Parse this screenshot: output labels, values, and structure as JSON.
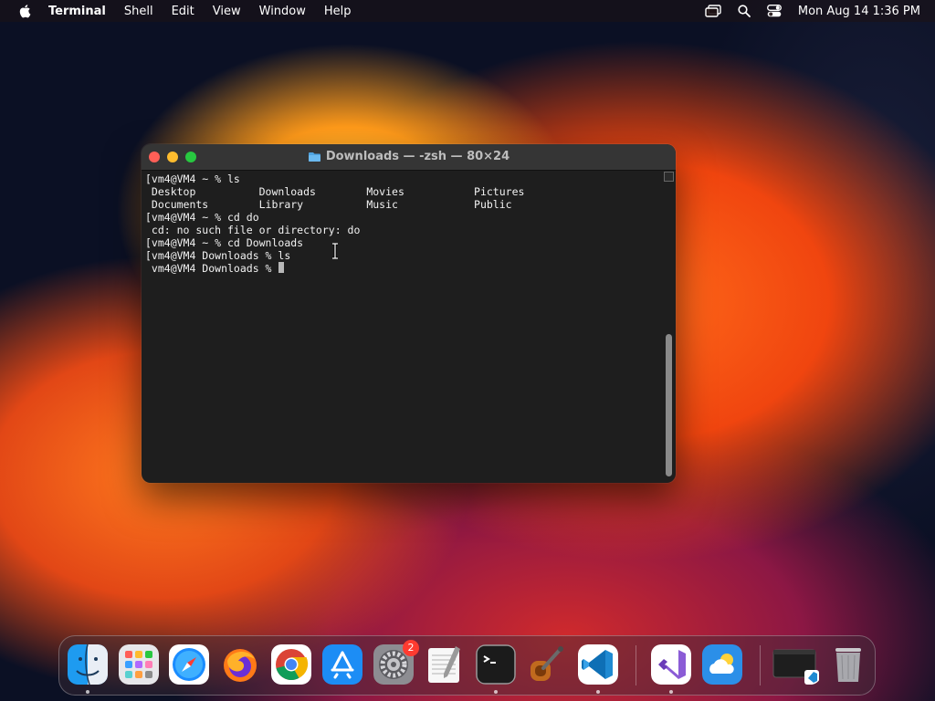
{
  "menubar": {
    "app_name": "Terminal",
    "items": [
      "Shell",
      "Edit",
      "View",
      "Window",
      "Help"
    ],
    "clock": "Mon Aug 14  1:36 PM"
  },
  "window": {
    "title": "Downloads — -zsh — 80×24",
    "lines": [
      "[vm4@VM4 ~ % ls",
      " Desktop          Downloads        Movies           Pictures",
      " Documents        Library          Music            Public",
      "[vm4@VM4 ~ % cd do",
      " cd: no such file or directory: do",
      "[vm4@VM4 ~ % cd Downloads",
      "[vm4@VM4 Downloads % ls",
      " vm4@VM4 Downloads % "
    ]
  },
  "dock": {
    "apps": [
      {
        "name": "Finder",
        "running": true
      },
      {
        "name": "Launchpad",
        "running": false
      },
      {
        "name": "Safari",
        "running": false
      },
      {
        "name": "Firefox",
        "running": false
      },
      {
        "name": "Google Chrome",
        "running": false
      },
      {
        "name": "App Store",
        "running": false
      },
      {
        "name": "System Settings",
        "running": false,
        "badge": "2"
      },
      {
        "name": "TextEdit",
        "running": false
      },
      {
        "name": "Terminal",
        "running": true
      },
      {
        "name": "Instruments",
        "running": false
      },
      {
        "name": "Visual Studio Code",
        "running": true
      },
      {
        "name": "Visual Studio",
        "running": true
      },
      {
        "name": "Weather",
        "running": false
      },
      {
        "name": "Minimized Window",
        "running": false
      },
      {
        "name": "Trash",
        "running": false
      }
    ]
  },
  "colors": {
    "window_bg": "#1e1e1e",
    "titlebar": "#353535",
    "close": "#ff5f57",
    "minimize": "#febc2e",
    "maximize": "#28c840"
  }
}
